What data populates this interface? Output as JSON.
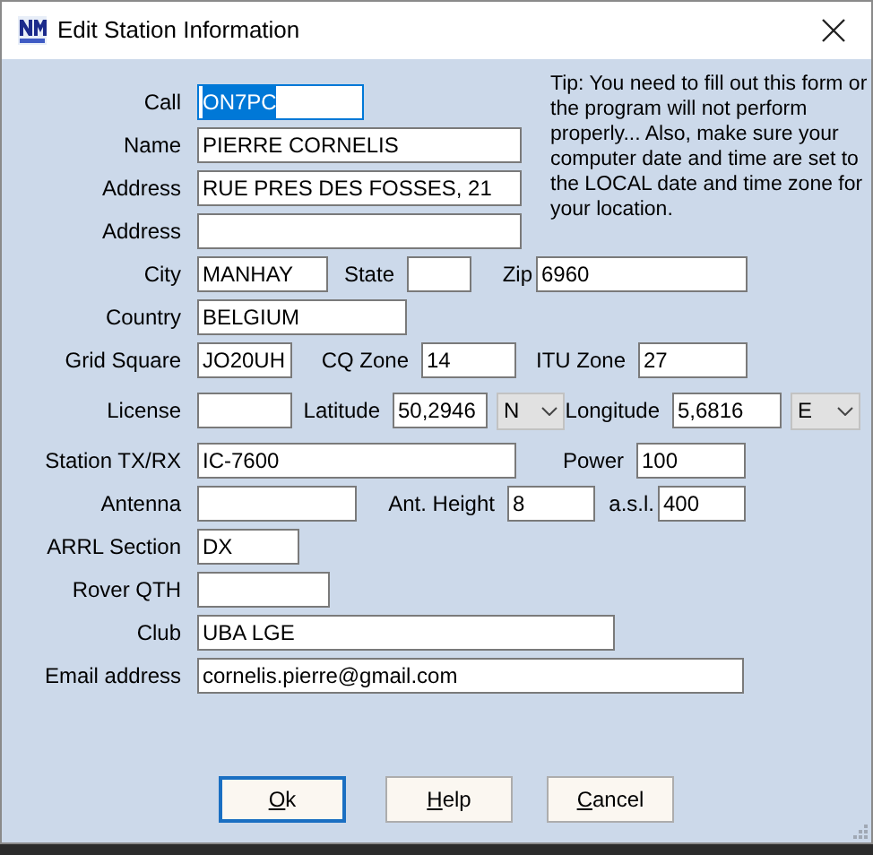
{
  "window": {
    "title": "Edit Station Information"
  },
  "tip": "Tip: You need to fill out this form or the program will not perform properly... Also, make sure your computer date and time are set to the LOCAL date and time zone for your location.",
  "rows": [
    [
      {
        "kind": "field",
        "label": "Call",
        "value": "ON7PC",
        "highlighted": true
      }
    ],
    [
      {
        "kind": "field",
        "label": "Name",
        "value": "PIERRE CORNELIS",
        "highlighted": false
      }
    ],
    [
      {
        "kind": "field",
        "label": "Address",
        "value": "RUE PRES DES FOSSES, 21",
        "highlighted": false
      }
    ],
    [
      {
        "kind": "field",
        "label": "Address",
        "highlighted": false
      }
    ],
    [
      {
        "kind": "field",
        "label": "City",
        "value": "MANHAY",
        "highlighted": false
      },
      {
        "kind": "field",
        "label": "State",
        "highlighted": false
      },
      {
        "kind": "field",
        "label": "Zip",
        "value": "6960",
        "highlighted": false
      }
    ],
    [
      {
        "kind": "field",
        "label": "Country",
        "value": "BELGIUM",
        "highlighted": false
      }
    ],
    [
      {
        "kind": "field",
        "label": "Grid Square",
        "value": "JO20UH",
        "highlighted": false
      },
      {
        "kind": "field",
        "label": "CQ Zone",
        "value": "14",
        "highlighted": false
      },
      {
        "kind": "field",
        "label": "ITU Zone",
        "value": "27",
        "highlighted": false
      }
    ],
    [
      {
        "kind": "field",
        "label": "License",
        "highlighted": false
      },
      {
        "kind": "field",
        "label": "Latitude",
        "value": "50,2946",
        "highlighted": false
      },
      {
        "kind": "select",
        "value": "N"
      },
      {
        "kind": "field",
        "label": "Longitude",
        "value": "5,6816",
        "highlighted": false
      },
      {
        "kind": "select",
        "value": "E"
      }
    ],
    [
      {
        "kind": "field",
        "label": "Station TX/RX",
        "value": "IC-7600",
        "highlighted": false
      },
      {
        "kind": "field",
        "label": "Power",
        "value": "100",
        "highlighted": false
      }
    ],
    [
      {
        "kind": "field",
        "label": "Antenna",
        "highlighted": false
      },
      {
        "kind": "field",
        "label": "Ant. Height",
        "value": "8",
        "highlighted": false
      },
      {
        "kind": "field",
        "label": "a.s.l.",
        "value": "400",
        "highlighted": false
      }
    ],
    [
      {
        "kind": "field",
        "label": "ARRL Section",
        "value": "DX",
        "highlighted": false
      }
    ],
    [
      {
        "kind": "field",
        "label": "Rover QTH",
        "highlighted": false
      }
    ],
    [
      {
        "kind": "field",
        "label": "Club",
        "value": "UBA LGE",
        "highlighted": false
      }
    ],
    [
      {
        "kind": "field",
        "label": "Email address",
        "value": "cornelis.pierre@gmail.com",
        "highlighted": false
      }
    ]
  ],
  "buttons": [
    {
      "accel": "O",
      "rest": "k",
      "focused": true
    },
    {
      "accel": "H",
      "rest": "elp",
      "focused": false
    },
    {
      "accel": "C",
      "rest": "ancel",
      "focused": false
    }
  ]
}
